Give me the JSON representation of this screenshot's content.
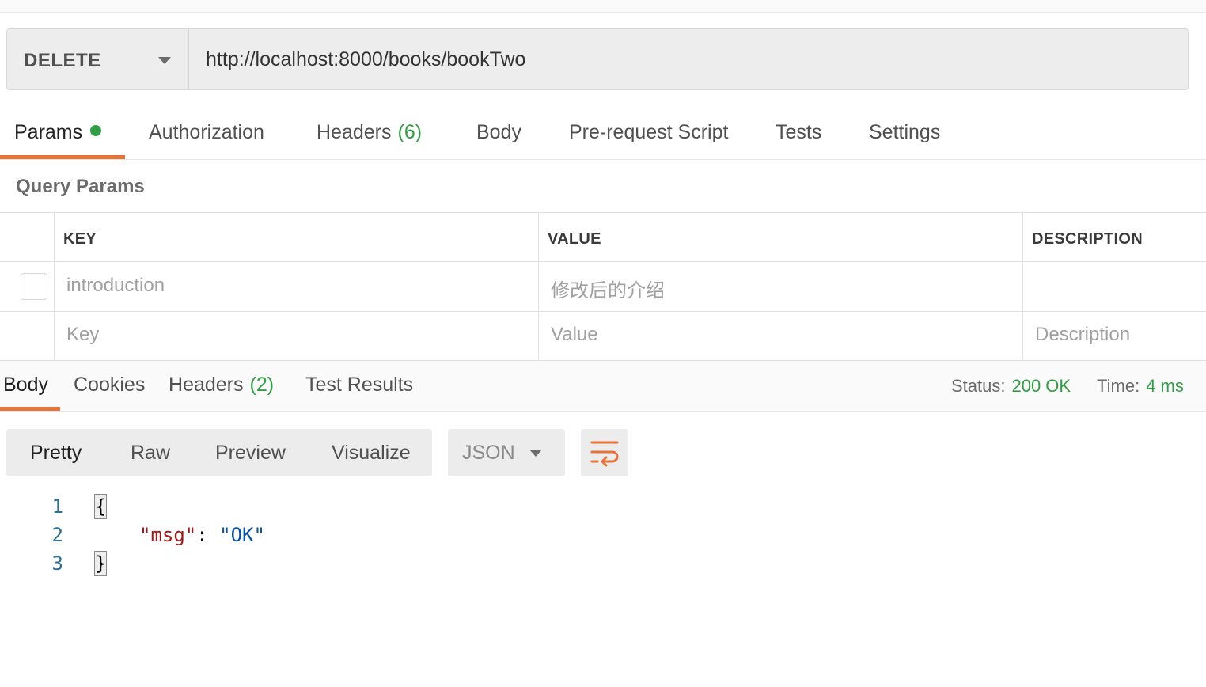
{
  "request": {
    "method": "DELETE",
    "url": "http://localhost:8000/books/bookTwo"
  },
  "request_tabs": {
    "params": "Params",
    "authorization": "Authorization",
    "headers": "Headers",
    "headers_count": "(6)",
    "body": "Body",
    "prerequest": "Pre-request Script",
    "tests": "Tests",
    "settings": "Settings"
  },
  "query_params": {
    "title": "Query Params",
    "columns": {
      "key": "KEY",
      "value": "VALUE",
      "description": "DESCRIPTION"
    },
    "rows": [
      {
        "key": "introduction",
        "value": "修改后的介绍",
        "description": ""
      }
    ],
    "new_row_placeholders": {
      "key": "Key",
      "value": "Value",
      "description": "Description"
    }
  },
  "response_tabs": {
    "body": "Body",
    "cookies": "Cookies",
    "headers": "Headers",
    "headers_count": "(2)",
    "test_results": "Test Results"
  },
  "response_status": {
    "status_label": "Status:",
    "status_value": "200 OK",
    "time_label": "Time:",
    "time_value": "4 ms"
  },
  "view_modes": [
    "Pretty",
    "Raw",
    "Preview",
    "Visualize"
  ],
  "format": "JSON",
  "code": {
    "lines": [
      "1",
      "2",
      "3"
    ],
    "open_brace": "{",
    "key": "\"msg\"",
    "colon": ": ",
    "value": "\"OK\"",
    "close_brace": "}"
  },
  "colors": {
    "accent": "#e8733a",
    "success": "#2f9e44",
    "json_key": "#a31515",
    "json_value": "#0451a5",
    "line_number": "#2a6f97"
  },
  "icons": [
    "chevron-down-icon",
    "wrap-lines-icon",
    "status-dot-icon"
  ]
}
